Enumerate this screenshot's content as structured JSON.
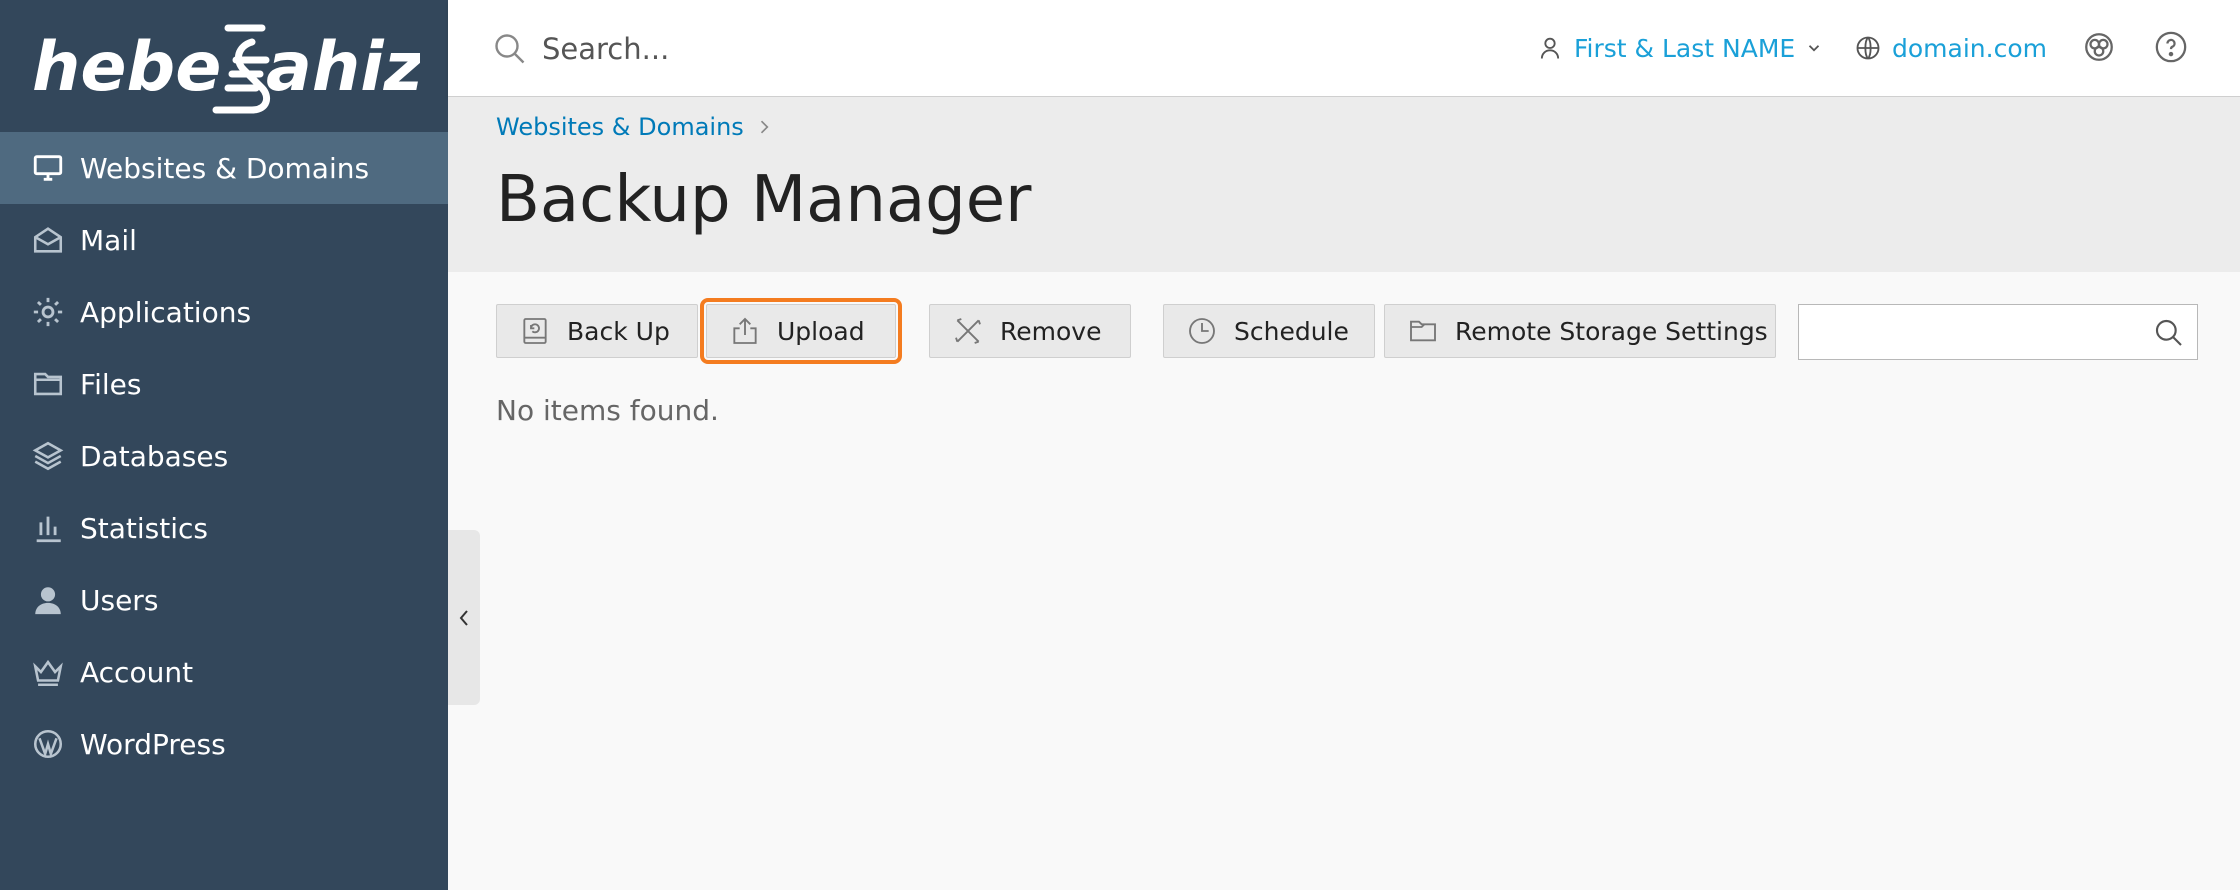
{
  "brand": {
    "logo_text": "hebe≡Jahiz"
  },
  "sidebar": {
    "items": [
      {
        "label": "Websites & Domains",
        "icon": "monitor-icon",
        "active": true
      },
      {
        "label": "Mail",
        "icon": "mail-icon"
      },
      {
        "label": "Applications",
        "icon": "gear-icon"
      },
      {
        "label": "Files",
        "icon": "folder-icon"
      },
      {
        "label": "Databases",
        "icon": "layers-icon"
      },
      {
        "label": "Statistics",
        "icon": "bar-chart-icon"
      },
      {
        "label": "Users",
        "icon": "user-icon"
      },
      {
        "label": "Account",
        "icon": "crown-icon"
      },
      {
        "label": "WordPress",
        "icon": "wordpress-icon"
      }
    ]
  },
  "topbar": {
    "search_placeholder": "Search...",
    "user_name": "First & Last NAME",
    "domain": "domain.com",
    "accent_color": "#1aa0d8"
  },
  "header": {
    "breadcrumb": "Websites & Domains",
    "title": "Backup Manager"
  },
  "toolbar": {
    "backup": "Back Up",
    "upload": "Upload",
    "remove": "Remove",
    "schedule": "Schedule",
    "remote_storage": "Remote Storage Settings",
    "search_placeholder": "",
    "highlight_color": "#f47c20"
  },
  "list": {
    "empty_text": "No items found."
  }
}
